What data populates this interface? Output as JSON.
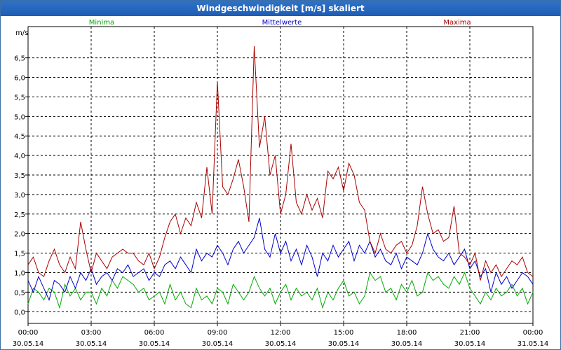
{
  "window": {
    "title": "Windgeschwindigkeit [m/s] skaliert"
  },
  "chart_data": {
    "type": "line",
    "title": "Windgeschwindigkeit [m/s] skaliert",
    "ylabel": "m/s",
    "xlabel": "",
    "ylim": [
      -0.3,
      7.3
    ],
    "xlim": [
      0,
      24
    ],
    "grid": true,
    "legend_position": "top",
    "y_ticks": [
      "0,0",
      "0,5",
      "1,0",
      "1,5",
      "2,0",
      "2,5",
      "3,0",
      "3,5",
      "4,0",
      "4,5",
      "5,0",
      "5,5",
      "6,0",
      "6,5"
    ],
    "y_tick_values": [
      0,
      0.5,
      1,
      1.5,
      2,
      2.5,
      3,
      3.5,
      4,
      4.5,
      5,
      5.5,
      6,
      6.5
    ],
    "x_ticks": [
      {
        "time": "00:00",
        "date": "30.05.14"
      },
      {
        "time": "03:00",
        "date": "30.05.14"
      },
      {
        "time": "06:00",
        "date": "30.05.14"
      },
      {
        "time": "09:00",
        "date": "30.05.14"
      },
      {
        "time": "12:00",
        "date": "30.05.14"
      },
      {
        "time": "15:00",
        "date": "30.05.14"
      },
      {
        "time": "18:00",
        "date": "30.05.14"
      },
      {
        "time": "21:00",
        "date": "30.05.14"
      },
      {
        "time": "00:00",
        "date": "31.05.14"
      }
    ],
    "series": [
      {
        "name": "Minima",
        "color": "#00aa00",
        "x": [
          0,
          0.25,
          0.5,
          0.75,
          1,
          1.25,
          1.5,
          1.75,
          2,
          2.25,
          2.5,
          2.75,
          3,
          3.25,
          3.5,
          3.75,
          4,
          4.25,
          4.5,
          4.75,
          5,
          5.25,
          5.5,
          5.75,
          6,
          6.25,
          6.5,
          6.75,
          7,
          7.25,
          7.5,
          7.75,
          8,
          8.25,
          8.5,
          8.75,
          9,
          9.25,
          9.5,
          9.75,
          10,
          10.25,
          10.5,
          10.75,
          11,
          11.25,
          11.5,
          11.75,
          12,
          12.25,
          12.5,
          12.75,
          13,
          13.25,
          13.5,
          13.75,
          14,
          14.25,
          14.5,
          14.75,
          15,
          15.25,
          15.5,
          15.75,
          16,
          16.25,
          16.5,
          16.75,
          17,
          17.25,
          17.5,
          17.75,
          18,
          18.25,
          18.5,
          18.75,
          19,
          19.25,
          19.5,
          19.75,
          20,
          20.25,
          20.5,
          20.75,
          21,
          21.25,
          21.5,
          21.75,
          22,
          22.25,
          22.5,
          22.75,
          23,
          23.25,
          23.5,
          23.75,
          24
        ],
        "values": [
          0.2,
          0.6,
          0.5,
          0.3,
          0.6,
          0.5,
          0.1,
          0.7,
          0.4,
          0.6,
          0.3,
          0.5,
          0.5,
          0.2,
          0.6,
          0.4,
          0.8,
          0.6,
          0.9,
          0.8,
          0.7,
          0.5,
          0.6,
          0.3,
          0.4,
          0.5,
          0.2,
          0.7,
          0.3,
          0.5,
          0.2,
          0.1,
          0.6,
          0.3,
          0.4,
          0.2,
          0.6,
          0.5,
          0.2,
          0.7,
          0.5,
          0.3,
          0.5,
          0.9,
          0.6,
          0.4,
          0.6,
          0.2,
          0.5,
          0.7,
          0.3,
          0.6,
          0.4,
          0.5,
          0.3,
          0.6,
          0.1,
          0.5,
          0.3,
          0.6,
          0.8,
          0.4,
          0.5,
          0.2,
          0.4,
          1.0,
          0.8,
          0.9,
          0.5,
          0.6,
          0.3,
          0.7,
          0.5,
          0.8,
          0.4,
          0.5,
          1.0,
          0.8,
          0.9,
          0.7,
          0.6,
          0.9,
          0.7,
          1.0,
          0.6,
          0.4,
          0.2,
          0.5,
          0.3,
          0.6,
          0.4,
          0.5,
          0.7,
          0.4,
          0.6,
          0.2,
          0.5
        ]
      },
      {
        "name": "Mittelwerte",
        "color": "#0000cc",
        "x": [
          0,
          0.25,
          0.5,
          0.75,
          1,
          1.25,
          1.5,
          1.75,
          2,
          2.25,
          2.5,
          2.75,
          3,
          3.25,
          3.5,
          3.75,
          4,
          4.25,
          4.5,
          4.75,
          5,
          5.25,
          5.5,
          5.75,
          6,
          6.25,
          6.5,
          6.75,
          7,
          7.25,
          7.5,
          7.75,
          8,
          8.25,
          8.5,
          8.75,
          9,
          9.25,
          9.5,
          9.75,
          10,
          10.25,
          10.5,
          10.75,
          11,
          11.25,
          11.5,
          11.75,
          12,
          12.25,
          12.5,
          12.75,
          13,
          13.25,
          13.5,
          13.75,
          14,
          14.25,
          14.5,
          14.75,
          15,
          15.25,
          15.5,
          15.75,
          16,
          16.25,
          16.5,
          16.75,
          17,
          17.25,
          17.5,
          17.75,
          18,
          18.25,
          18.5,
          18.75,
          19,
          19.25,
          19.5,
          19.75,
          20,
          20.25,
          20.5,
          20.75,
          21,
          21.25,
          21.5,
          21.75,
          22,
          22.25,
          22.5,
          22.75,
          23,
          23.25,
          23.5,
          23.75,
          24
        ],
        "values": [
          0.8,
          0.5,
          0.9,
          0.6,
          0.3,
          0.8,
          0.7,
          0.5,
          0.9,
          0.6,
          1.0,
          0.8,
          1.1,
          0.7,
          0.9,
          1.0,
          0.8,
          1.1,
          1.0,
          1.2,
          0.9,
          1.0,
          1.1,
          0.8,
          1.0,
          0.9,
          1.2,
          1.3,
          1.1,
          1.4,
          1.2,
          1.0,
          1.6,
          1.3,
          1.5,
          1.4,
          1.7,
          1.5,
          1.2,
          1.6,
          1.8,
          1.5,
          1.7,
          1.9,
          2.4,
          1.6,
          1.4,
          2.0,
          1.5,
          1.8,
          1.3,
          1.6,
          1.2,
          1.7,
          1.4,
          0.9,
          1.5,
          1.3,
          1.7,
          1.4,
          1.6,
          1.8,
          1.3,
          1.7,
          1.5,
          1.8,
          1.4,
          1.6,
          1.3,
          1.2,
          1.5,
          1.1,
          1.4,
          1.3,
          1.2,
          1.5,
          2.0,
          1.6,
          1.4,
          1.3,
          1.5,
          1.2,
          1.4,
          1.6,
          1.1,
          1.3,
          0.9,
          1.1,
          0.5,
          1.0,
          0.7,
          0.9,
          0.6,
          0.8,
          1.0,
          0.9,
          0.7
        ]
      },
      {
        "name": "Maxima",
        "color": "#aa0000",
        "x": [
          0,
          0.25,
          0.5,
          0.75,
          1,
          1.25,
          1.5,
          1.75,
          2,
          2.25,
          2.5,
          2.75,
          3,
          3.25,
          3.5,
          3.75,
          4,
          4.25,
          4.5,
          4.75,
          5,
          5.25,
          5.5,
          5.75,
          6,
          6.25,
          6.5,
          6.75,
          7,
          7.25,
          7.5,
          7.75,
          8,
          8.25,
          8.5,
          8.75,
          9,
          9.25,
          9.5,
          9.75,
          10,
          10.25,
          10.5,
          10.75,
          11,
          11.25,
          11.5,
          11.75,
          12,
          12.25,
          12.5,
          12.75,
          13,
          13.25,
          13.5,
          13.75,
          14,
          14.25,
          14.5,
          14.75,
          15,
          15.25,
          15.5,
          15.75,
          16,
          16.25,
          16.5,
          16.75,
          17,
          17.25,
          17.5,
          17.75,
          18,
          18.25,
          18.5,
          18.75,
          19,
          19.25,
          19.5,
          19.75,
          20,
          20.25,
          20.5,
          20.75,
          21,
          21.25,
          21.5,
          21.75,
          22,
          22.25,
          22.5,
          22.75,
          23,
          23.25,
          23.5,
          23.75,
          24
        ],
        "values": [
          1.2,
          1.4,
          1.0,
          0.9,
          1.3,
          1.6,
          1.2,
          1.0,
          1.4,
          1.1,
          2.3,
          1.6,
          1.0,
          1.5,
          1.3,
          1.1,
          1.4,
          1.5,
          1.6,
          1.5,
          1.5,
          1.3,
          1.2,
          1.5,
          1.1,
          1.4,
          1.9,
          2.3,
          2.5,
          2.0,
          2.4,
          2.2,
          2.8,
          2.4,
          3.7,
          2.5,
          5.9,
          3.2,
          3.0,
          3.4,
          3.9,
          3.2,
          2.3,
          6.8,
          4.2,
          5.0,
          3.5,
          4.0,
          2.5,
          3.0,
          4.3,
          2.8,
          2.5,
          3.0,
          2.6,
          2.9,
          2.4,
          3.6,
          3.4,
          3.7,
          3.1,
          3.8,
          3.5,
          2.8,
          2.6,
          1.8,
          1.5,
          2.0,
          1.6,
          1.5,
          1.7,
          1.8,
          1.5,
          1.7,
          2.2,
          3.2,
          2.5,
          2.0,
          2.1,
          1.8,
          1.9,
          2.7,
          1.5,
          1.4,
          1.2,
          1.5,
          0.8,
          1.3,
          1.0,
          1.2,
          0.9,
          1.1,
          1.3,
          1.2,
          1.4,
          1.0,
          0.9
        ]
      }
    ]
  }
}
